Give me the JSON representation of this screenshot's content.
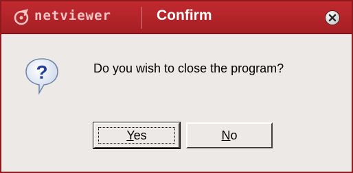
{
  "titlebar": {
    "brand": "netviewer",
    "title": "Confirm",
    "brand_icon": "netviewer-logo-icon",
    "close_icon": "close-icon"
  },
  "dialog": {
    "icon": "question-icon",
    "message": "Do you wish to close the program?"
  },
  "buttons": {
    "yes": {
      "mnemonic": "Y",
      "rest": "es"
    },
    "no": {
      "mnemonic": "N",
      "rest": "o"
    }
  },
  "colors": {
    "titlebar": "#b3252a",
    "dialog_bg": "#ece9e6"
  }
}
